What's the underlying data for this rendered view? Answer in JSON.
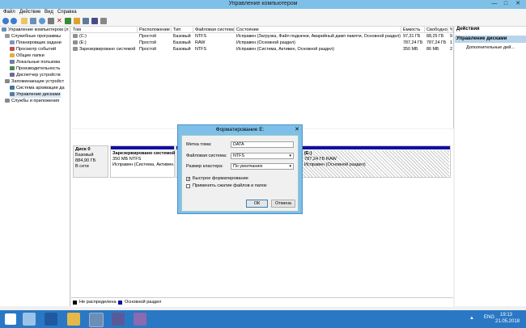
{
  "window": {
    "title": "Управление компьютером",
    "minimize": "—",
    "maximize": "□",
    "close": "✕"
  },
  "menu": [
    "Файл",
    "Действие",
    "Вид",
    "Справка"
  ],
  "toolbar": {
    "icons": [
      "back-icon",
      "forward-icon",
      "up-icon",
      "console-tree-icon",
      "help-icon",
      "properties-icon",
      "delete-icon",
      "refresh-icon",
      "folder-icon",
      "export-icon",
      "check-icon",
      "help2-icon"
    ]
  },
  "tree": {
    "root": "Управление компьютером (л",
    "items": [
      "Служебные программы",
      "Планировщик задани",
      "Просмотр событий",
      "Общие папки",
      "Локальные пользова",
      "Производительность",
      "Диспетчер устройств",
      "Запоминающие устройст",
      "Система архивации да",
      "Управление дисками",
      "Службы и приложения"
    ]
  },
  "list": {
    "columns": [
      "Том",
      "Расположение",
      "Тип",
      "Файловая система",
      "Состояние",
      "Емкость",
      "Свободно",
      "%"
    ],
    "rows": [
      [
        "(C:)",
        "Простой",
        "Базовый",
        "NTFS",
        "Исправен (Загрузка, Файл подкачки, Аварийный дамп памяти, Основной раздел)",
        "97,31 ГБ",
        "88,25 ГБ",
        "9"
      ],
      [
        "(E:)",
        "Простой",
        "Базовый",
        "RAW",
        "Исправен (Основной раздел)",
        "787,24 ГБ",
        "787,24 ГБ",
        "1"
      ],
      [
        "Зарезервировано системой",
        "Простой",
        "Базовый",
        "NTFS",
        "Исправен (Система, Активен, Основной раздел)",
        "350 МБ",
        "86 МБ",
        "2"
      ]
    ]
  },
  "disk": {
    "name": "Диск 0",
    "type": "Базовый",
    "size": "884,90 ГБ",
    "status": "В сети",
    "partitions": [
      {
        "title": "Зарезервировано системой",
        "line1": "350 МБ NTFS",
        "line2": "Исправен (Система, Активен,"
      },
      {
        "title": "(E:)",
        "line1": "787,24 ГБ RAW",
        "line2": "Исправен (Основной раздел)"
      }
    ]
  },
  "legend": {
    "unallocated": "Не распределена",
    "primary": "Основной раздел"
  },
  "actions": {
    "header": "Действия",
    "section": "Управление дисками",
    "more": "Дополнительные дей..."
  },
  "dialog": {
    "title": "Форматирование E:",
    "label_volume": "Метка тома:",
    "volume_value": "DATA",
    "label_fs": "Файловая система:",
    "fs_value": "NTFS",
    "label_cluster": "Размер кластера:",
    "cluster_value": "По умолчанию",
    "quick_format": "Быстрое форматирование",
    "compression": "Применять сжатие файлов и папок",
    "ok": "ОК",
    "cancel": "Отмена"
  },
  "taskbar": {
    "lang": "ENG",
    "time": "19:13",
    "date": "21.05.2018"
  },
  "colors": {
    "titlebar": "#7ec0e8",
    "primary_partition": "#1010a0",
    "unallocated": "#000000",
    "taskbar": "#2a78c4",
    "actions_header": "#b7d4ea"
  }
}
